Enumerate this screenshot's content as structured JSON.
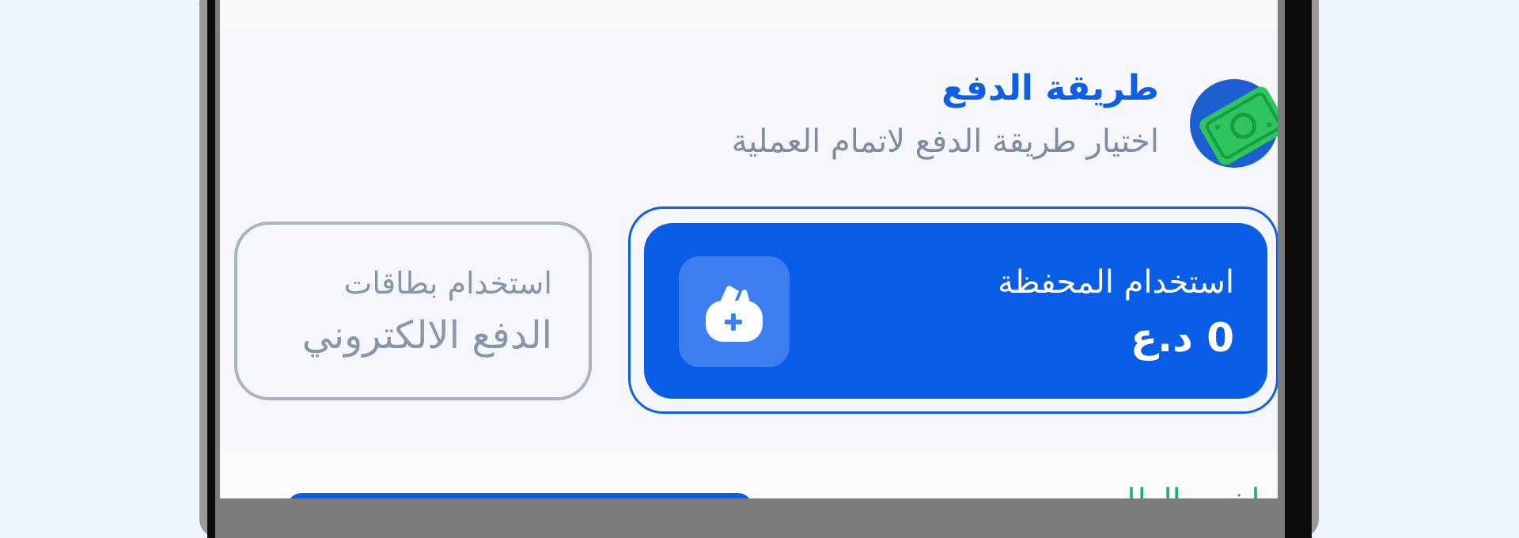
{
  "payment_method": {
    "title": "طريقة الدفع",
    "subtitle": "اختيار طريقة الدفع لاتمام العملية",
    "icon": "money-bill-icon"
  },
  "options": {
    "wallet": {
      "label": "استخدام المحفظة",
      "balance": "0 د.ع",
      "icon": "wallet-plus-icon",
      "selected": true
    },
    "epay": {
      "line1": "استخدام  بطاقات",
      "line2": "الدفع الالكتروني",
      "selected": false
    }
  },
  "next_section": {
    "title": "ملخص الطلب"
  },
  "colors": {
    "accent": "#0a5de6",
    "muted_text": "#7e8ba0",
    "unselected_border": "#a8b3c4",
    "money_green": "#2ec55e"
  }
}
